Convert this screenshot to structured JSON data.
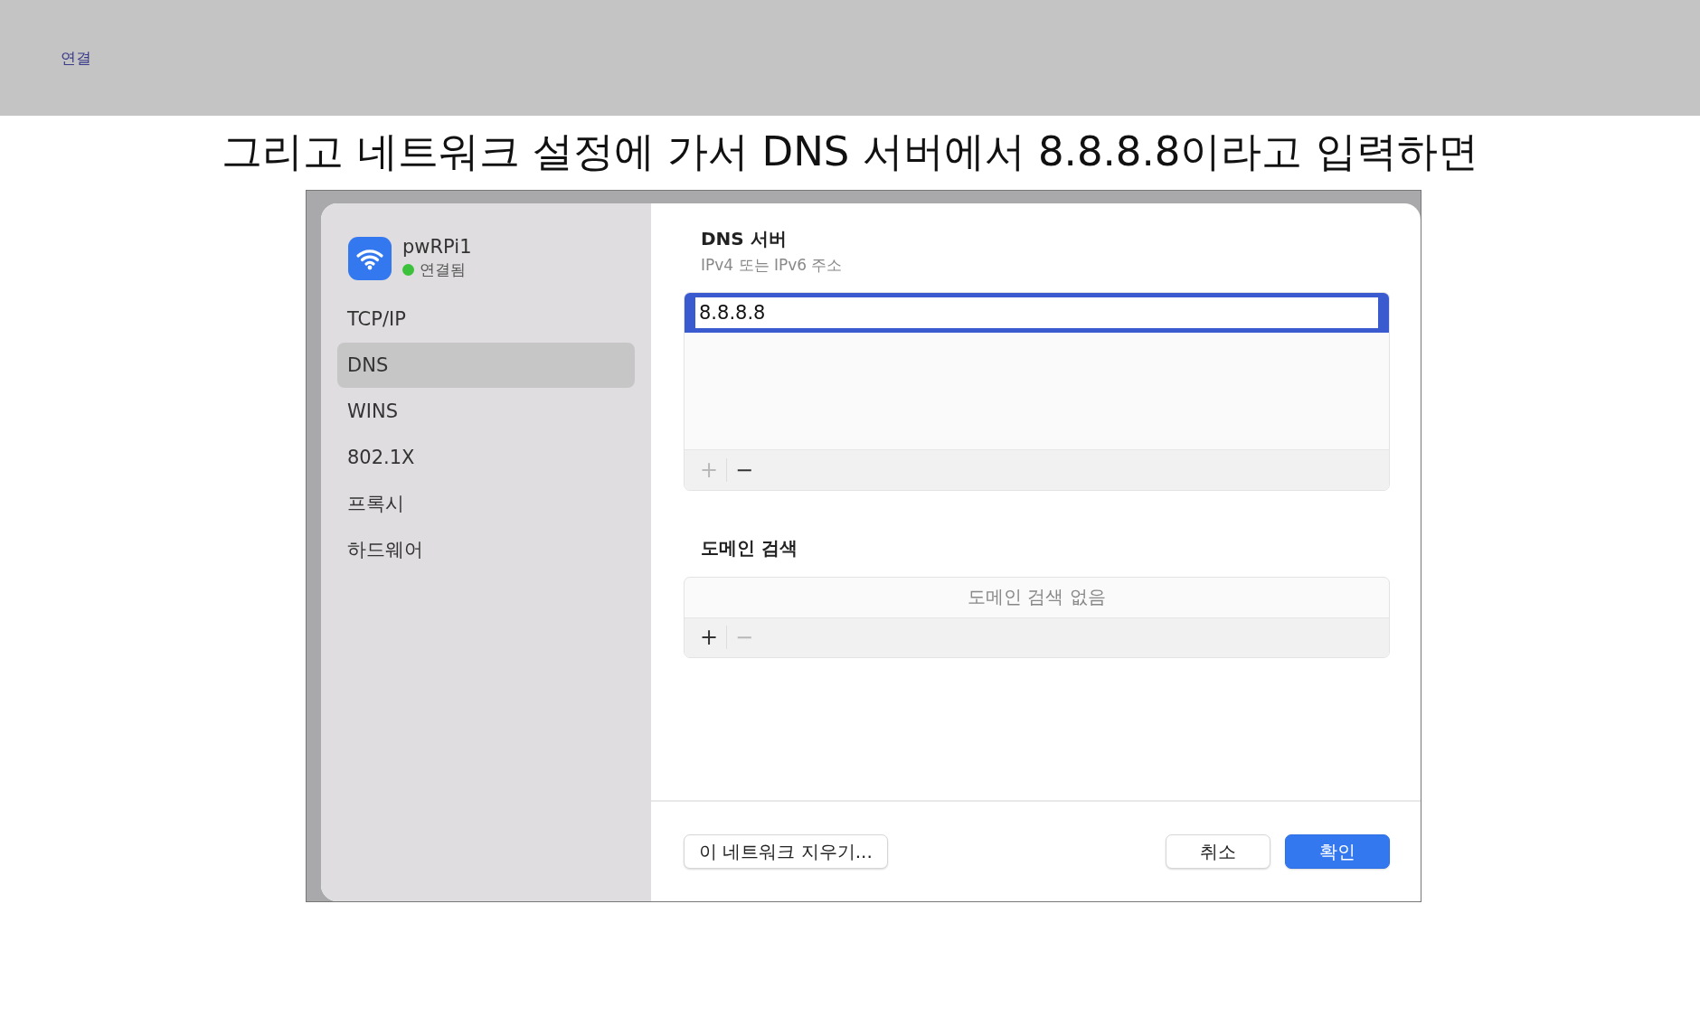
{
  "top_bar": {
    "label": "연결"
  },
  "caption": "그리고 네트워크 설정에 가서 DNS 서버에서 8.8.8.8이라고 입력하면",
  "dialog": {
    "network": {
      "name": "pwRPi1",
      "status": "연결됨",
      "connected": true
    },
    "sidebar": {
      "items": [
        {
          "label": "TCP/IP",
          "selected": false
        },
        {
          "label": "DNS",
          "selected": true
        },
        {
          "label": "WINS",
          "selected": false
        },
        {
          "label": "802.1X",
          "selected": false
        },
        {
          "label": "프록시",
          "selected": false
        },
        {
          "label": "하드웨어",
          "selected": false
        }
      ]
    },
    "dns_servers": {
      "title": "DNS 서버",
      "subtitle": "IPv4 또는 IPv6 주소",
      "entries": [
        {
          "value": "8.8.8.8",
          "selected": true
        }
      ],
      "add": {
        "label": "+",
        "disabled": true
      },
      "remove": {
        "label": "−",
        "disabled": false
      }
    },
    "domain_search": {
      "title": "도메인 검색",
      "empty_text": "도메인 검색 없음",
      "add": {
        "label": "+",
        "disabled": false
      },
      "remove": {
        "label": "−",
        "disabled": true
      }
    },
    "footer": {
      "buttons": [
        {
          "label": "이 네트워크 지우기...",
          "kind": "default"
        },
        {
          "label": "취소",
          "kind": "default"
        },
        {
          "label": "확인",
          "kind": "primary"
        }
      ]
    }
  }
}
